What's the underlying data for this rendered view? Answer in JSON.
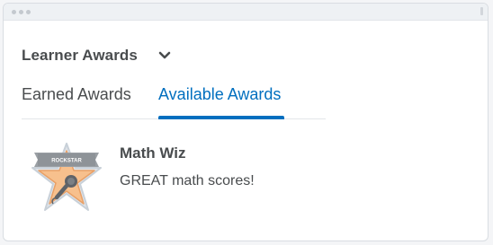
{
  "widget": {
    "title": "Learner Awards"
  },
  "tabs": [
    {
      "label": "Earned Awards",
      "selected": false
    },
    {
      "label": "Available Awards",
      "selected": true
    }
  ],
  "awards": [
    {
      "name": "Math Wiz",
      "description": "GREAT math scores!",
      "badge_banner": "ROCKSTAR",
      "badge_icon": "microphone-icon"
    }
  ],
  "colors": {
    "accent": "#006fbf",
    "text": "#494c4e",
    "badge_star": "#f7c08d",
    "badge_outline": "#c8d0d8",
    "badge_banner": "#9a9fa4"
  }
}
